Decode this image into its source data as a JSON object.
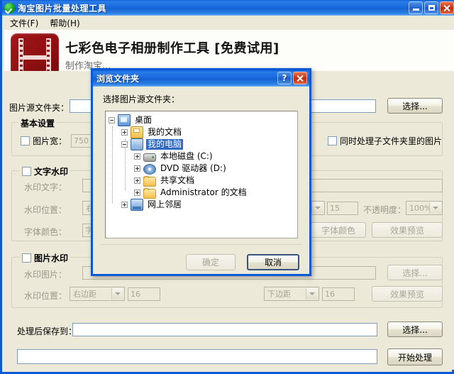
{
  "window": {
    "title": "淘宝图片批量处理工具",
    "icon": "green-check-icon",
    "minimize_label": "最小化",
    "maximize_label": "最大化",
    "close_label": "关闭"
  },
  "menu": {
    "items": [
      {
        "label": "文件(F)"
      },
      {
        "label": "帮助(H)"
      }
    ]
  },
  "banner": {
    "icon": "film-strip-icon",
    "title": "七彩色电子相册制作工具 [免费试用]",
    "subtitle": "制作淘宝..."
  },
  "form": {
    "source_folder": {
      "label": "图片源文件夹：",
      "value": "",
      "browse_label": "选择..."
    },
    "basic_settings": {
      "title": "基本设置",
      "image_width": {
        "checkbox_label": "图片宽：",
        "checked": false,
        "value": "750"
      },
      "include_subfolders": {
        "label": "同时处理子文件夹里的图片",
        "checked": false
      }
    },
    "text_watermark": {
      "title": "文字水印",
      "checked": false,
      "text": {
        "label": "水印文字：",
        "value": ""
      },
      "position": {
        "label": "水印位置：",
        "h_anchor": "右边距",
        "h_value": "15",
        "opacity_label": "不透明度：",
        "opacity_value": "100%"
      },
      "font": {
        "label": "字体颜色：",
        "value": "字体:Ar",
        "color_button": "字体颜色",
        "preview_button": "效果预览"
      }
    },
    "image_watermark": {
      "title": "图片水印",
      "checked": false,
      "image": {
        "label": "水印图片：",
        "value": "",
        "browse_label": "选择..."
      },
      "position": {
        "label": "水印位置：",
        "h_anchor": "右边距",
        "h_value": "16",
        "v_anchor": "下边距",
        "v_value": "16",
        "preview_button": "效果预览"
      }
    },
    "output": {
      "label": "处理后保存到：",
      "value": "",
      "browse_label": "选择..."
    },
    "progress": {
      "value": "",
      "start_label": "开始处理"
    }
  },
  "dialog": {
    "title": "浏览文件夹",
    "help_label": "?",
    "close_label": "×",
    "prompt": "选择图片源文件夹：",
    "tree": [
      {
        "label": "桌面",
        "icon": "desktop",
        "depth": 0,
        "expander": "minus",
        "selected": false
      },
      {
        "label": "我的文档",
        "icon": "mydocs",
        "depth": 1,
        "expander": "plus",
        "selected": false
      },
      {
        "label": "我的电脑",
        "icon": "mycomp",
        "depth": 1,
        "expander": "minus",
        "selected": true
      },
      {
        "label": "本地磁盘 (C:)",
        "icon": "hdd",
        "depth": 2,
        "expander": "plus",
        "selected": false
      },
      {
        "label": "DVD 驱动器 (D:)",
        "icon": "dvd",
        "depth": 2,
        "expander": "plus",
        "selected": false
      },
      {
        "label": "共享文档",
        "icon": "folder",
        "depth": 2,
        "expander": "plus",
        "selected": false
      },
      {
        "label": "Administrator 的文档",
        "icon": "folder",
        "depth": 2,
        "expander": "plus",
        "selected": false
      },
      {
        "label": "网上邻居",
        "icon": "network",
        "depth": 1,
        "expander": "plus",
        "selected": false
      }
    ],
    "ok_label": "确定",
    "ok_enabled": false,
    "cancel_label": "取消"
  },
  "colors": {
    "titlebar_blue": "#1868dc",
    "window_face": "#ece9d8",
    "selection_blue": "#316ac5",
    "banner_icon_red": "#8e0f12",
    "dialog_border": "#0a5ad6"
  }
}
